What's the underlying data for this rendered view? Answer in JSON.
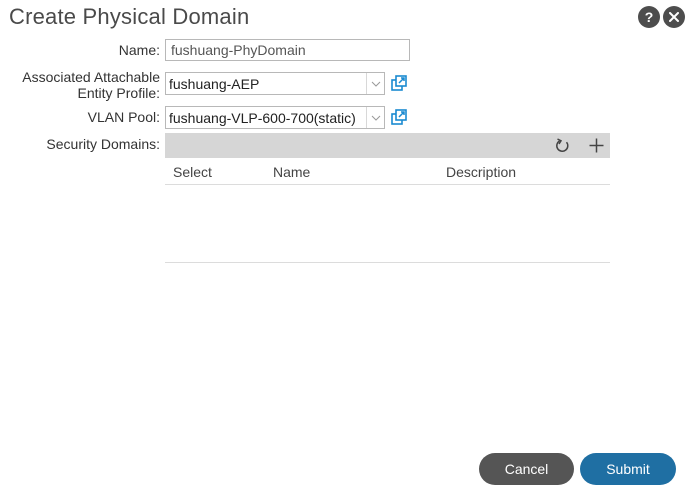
{
  "dialog": {
    "title": "Create Physical Domain",
    "help_icon": "question-icon",
    "close_icon": "close-icon"
  },
  "form": {
    "name": {
      "label": "Name:",
      "value": "fushuang-PhyDomain"
    },
    "aep": {
      "label_line1": "Associated Attachable",
      "label_line2": "Entity Profile:",
      "value": "fushuang-AEP"
    },
    "vlan_pool": {
      "label": "VLAN Pool:",
      "value": "fushuang-VLP-600-700(static)"
    },
    "security_domains": {
      "label": "Security Domains:",
      "columns": [
        "Select",
        "Name",
        "Description"
      ],
      "rows": []
    }
  },
  "footer": {
    "cancel_label": "Cancel",
    "submit_label": "Submit"
  },
  "colors": {
    "submit": "#1f6fa3",
    "cancel": "#555555",
    "link_icon": "#1a8ad0"
  }
}
